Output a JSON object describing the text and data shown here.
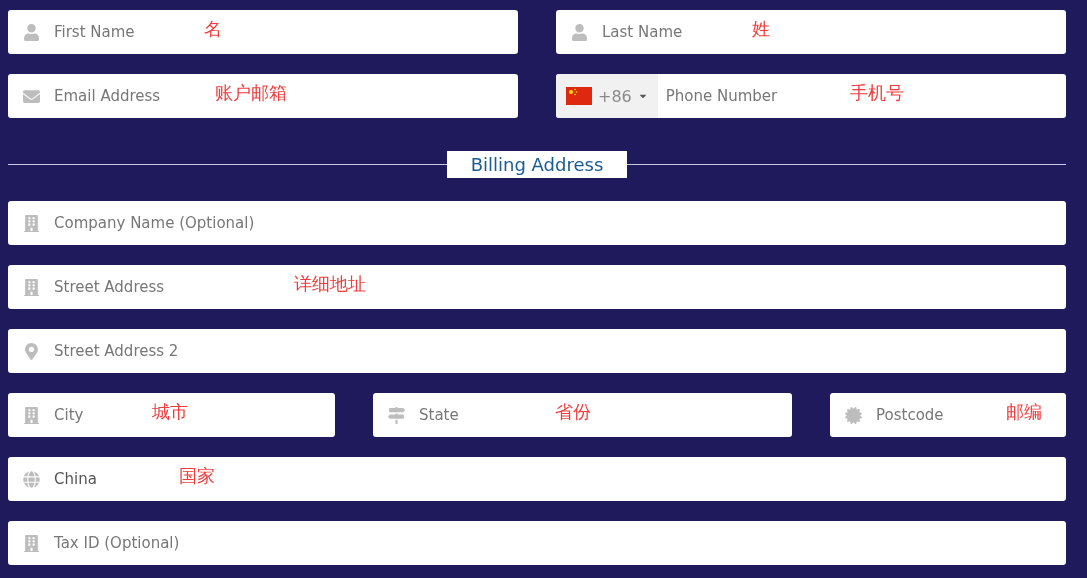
{
  "sections": [
    {
      "kind": "fields",
      "rows": [
        {
          "fields": [
            {
              "kind": "name",
              "placeholder": "First Name",
              "note": "名"
            },
            {
              "kind": "name",
              "placeholder": "Last Name",
              "note": "姓"
            }
          ]
        },
        {
          "fields": [
            {
              "kind": "email",
              "placeholder": "Email Address",
              "note": "账户邮箱"
            },
            {
              "kind": "phone",
              "dial_code": "+86",
              "placeholder": "Phone Number",
              "note": "手机号"
            }
          ]
        }
      ]
    },
    {
      "kind": "divider",
      "title": "Billing Address"
    },
    {
      "kind": "fields",
      "rows": [
        {
          "fields": [
            {
              "kind": "building",
              "placeholder": "Company Name (Optional)"
            }
          ]
        },
        {
          "fields": [
            {
              "kind": "building",
              "placeholder": "Street Address",
              "note": "详细地址"
            }
          ]
        },
        {
          "fields": [
            {
              "kind": "pin",
              "placeholder": "Street Address 2"
            }
          ]
        },
        {
          "fields": [
            {
              "kind": "building",
              "placeholder": "City",
              "note": "城市"
            },
            {
              "kind": "state",
              "placeholder": "State",
              "note": "省份"
            },
            {
              "kind": "postcode",
              "placeholder": "Postcode",
              "note": "邮编"
            }
          ]
        },
        {
          "fields": [
            {
              "kind": "country",
              "value": "China",
              "note": "国家"
            }
          ]
        },
        {
          "fields": [
            {
              "kind": "building",
              "placeholder": "Tax ID (Optional)"
            }
          ]
        }
      ]
    }
  ]
}
